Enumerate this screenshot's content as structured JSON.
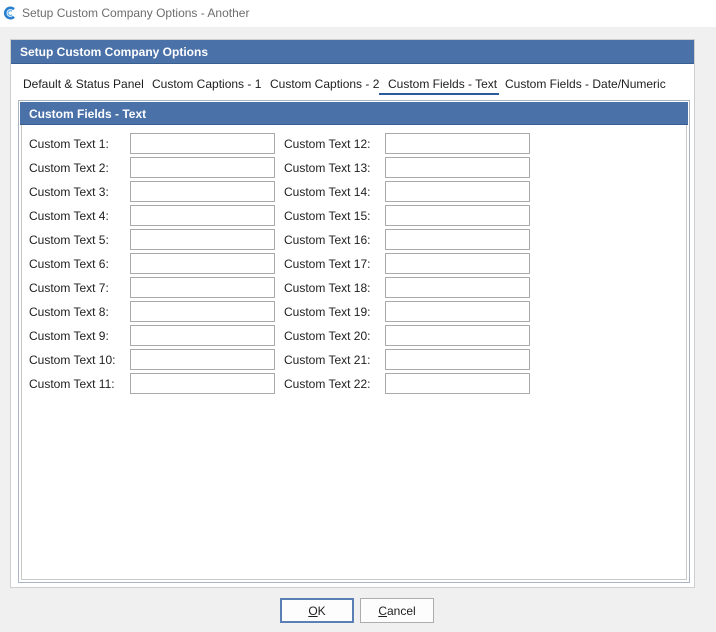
{
  "window": {
    "title": "Setup Custom Company Options - Another",
    "app_icon": "c-logo-icon"
  },
  "panel": {
    "title": "Setup Custom Company Options"
  },
  "tabs": [
    {
      "label": "Default & Status Panel",
      "active": false
    },
    {
      "label": "Custom Captions - 1",
      "active": false
    },
    {
      "label": "Custom Captions - 2",
      "active": false
    },
    {
      "label": "Custom Fields - Text",
      "active": true
    },
    {
      "label": "Custom Fields - Date/Numeric",
      "active": false
    }
  ],
  "section": {
    "title": "Custom Fields - Text"
  },
  "fields": {
    "left": [
      {
        "label": "Custom Text 1:",
        "value": ""
      },
      {
        "label": "Custom Text 2:",
        "value": ""
      },
      {
        "label": "Custom Text 3:",
        "value": ""
      },
      {
        "label": "Custom Text 4:",
        "value": ""
      },
      {
        "label": "Custom Text 5:",
        "value": ""
      },
      {
        "label": "Custom Text 6:",
        "value": ""
      },
      {
        "label": "Custom Text 7:",
        "value": ""
      },
      {
        "label": "Custom Text 8:",
        "value": ""
      },
      {
        "label": "Custom Text 9:",
        "value": ""
      },
      {
        "label": "Custom Text 10:",
        "value": ""
      },
      {
        "label": "Custom Text 11:",
        "value": ""
      }
    ],
    "right": [
      {
        "label": "Custom Text 12:",
        "value": ""
      },
      {
        "label": "Custom Text 13:",
        "value": ""
      },
      {
        "label": "Custom Text 14:",
        "value": ""
      },
      {
        "label": "Custom Text 15:",
        "value": ""
      },
      {
        "label": "Custom Text 16:",
        "value": ""
      },
      {
        "label": "Custom Text 17:",
        "value": ""
      },
      {
        "label": "Custom Text 18:",
        "value": ""
      },
      {
        "label": "Custom Text 19:",
        "value": ""
      },
      {
        "label": "Custom Text 20:",
        "value": ""
      },
      {
        "label": "Custom Text 21:",
        "value": ""
      },
      {
        "label": "Custom Text 22:",
        "value": ""
      }
    ]
  },
  "buttons": {
    "ok": {
      "label_mnemonic": "O",
      "label_rest": "K"
    },
    "cancel": {
      "label_mnemonic": "C",
      "label_rest": "ancel"
    }
  },
  "colors": {
    "header_blue": "#4a71a8",
    "active_tab_underline": "#2c5aa0",
    "default_button_border": "#5a7fb5"
  }
}
